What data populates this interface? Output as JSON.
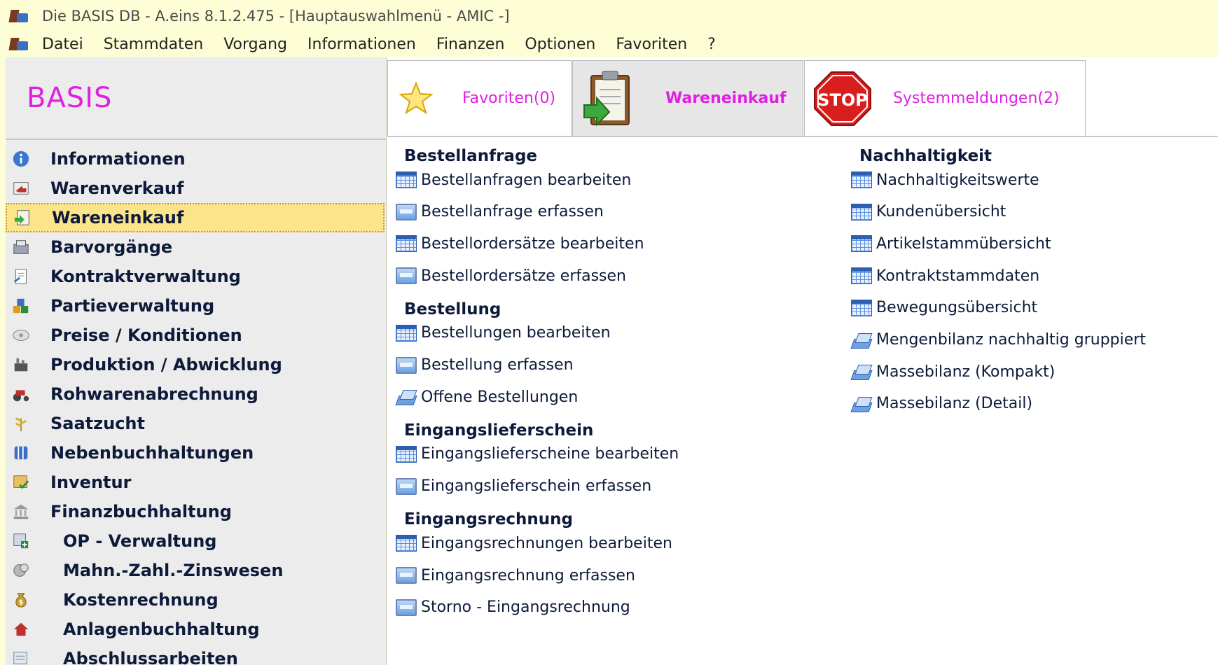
{
  "window": {
    "title": "Die BASIS DB - A.eins 8.1.2.475 - [Hauptauswahlmenü - AMIC -]"
  },
  "menu": [
    "Datei",
    "Stammdaten",
    "Vorgang",
    "Informationen",
    "Finanzen",
    "Optionen",
    "Favoriten",
    "?"
  ],
  "brand": "BASIS",
  "nav": [
    {
      "label": "Informationen",
      "icon": "info-icon"
    },
    {
      "label": "Warenverkauf",
      "icon": "sales-icon"
    },
    {
      "label": "Wareneinkauf",
      "icon": "purchase-icon",
      "active": true
    },
    {
      "label": "Barvorgänge",
      "icon": "cash-icon"
    },
    {
      "label": "Kontraktverwaltung",
      "icon": "contract-icon"
    },
    {
      "label": "Partieverwaltung",
      "icon": "batch-icon"
    },
    {
      "label": "Preise / Konditionen",
      "icon": "price-icon"
    },
    {
      "label": "Produktion / Abwicklung",
      "icon": "production-icon"
    },
    {
      "label": "Rohwarenabrechnung",
      "icon": "tractor-icon"
    },
    {
      "label": "Saatzucht",
      "icon": "seed-icon"
    },
    {
      "label": "Nebenbuchhaltungen",
      "icon": "ledger-icon"
    },
    {
      "label": "Inventur",
      "icon": "inventory-icon"
    },
    {
      "label": "Finanzbuchhaltung",
      "icon": "bank-icon"
    },
    {
      "label": "OP - Verwaltung",
      "icon": "op-icon",
      "sub": true
    },
    {
      "label": "Mahn.-Zahl.-Zinswesen",
      "icon": "dunning-icon",
      "sub": true
    },
    {
      "label": "Kostenrechnung",
      "icon": "moneybag-icon",
      "sub": true
    },
    {
      "label": "Anlagenbuchhaltung",
      "icon": "assets-icon",
      "sub": true
    },
    {
      "label": "Abschlussarbeiten",
      "icon": "closing-icon",
      "sub": true
    }
  ],
  "tabs": [
    {
      "label": "Favoriten(0)",
      "icon": "star-icon"
    },
    {
      "label": "Wareneinkauf",
      "icon": "clipboard-icon",
      "active": true
    },
    {
      "label": "Systemmeldungen(2)",
      "icon": "stop-icon"
    }
  ],
  "sections_left": [
    {
      "title": "Bestellanfrage",
      "items": [
        {
          "label": "Bestellanfragen bearbeiten",
          "icon": "table-icon"
        },
        {
          "label": "Bestellanfrage erfassen",
          "icon": "form-icon"
        },
        {
          "label": "Bestellordersätze bearbeiten",
          "icon": "table-icon"
        },
        {
          "label": "Bestellordersätze erfassen",
          "icon": "form-icon"
        }
      ]
    },
    {
      "title": "Bestellung",
      "items": [
        {
          "label": "Bestellungen bearbeiten",
          "icon": "table-icon"
        },
        {
          "label": "Bestellung erfassen",
          "icon": "form-icon"
        },
        {
          "label": "Offene Bestellungen",
          "icon": "report-icon"
        }
      ]
    },
    {
      "title": "Eingangslieferschein",
      "items": [
        {
          "label": "Eingangslieferscheine bearbeiten",
          "icon": "table-icon"
        },
        {
          "label": "Eingangslieferschein erfassen",
          "icon": "form-icon"
        }
      ]
    },
    {
      "title": "Eingangsrechnung",
      "items": [
        {
          "label": "Eingangsrechnungen bearbeiten",
          "icon": "table-icon"
        },
        {
          "label": "Eingangsrechnung erfassen",
          "icon": "form-icon"
        },
        {
          "label": "Storno - Eingangsrechnung",
          "icon": "form-icon"
        }
      ]
    }
  ],
  "sections_right": [
    {
      "title": "Nachhaltigkeit",
      "items": [
        {
          "label": "Nachhaltigkeitswerte",
          "icon": "table-icon"
        },
        {
          "label": "Kundenübersicht",
          "icon": "table-icon"
        },
        {
          "label": "Artikelstammübersicht",
          "icon": "table-icon"
        },
        {
          "label": "Kontraktstammdaten",
          "icon": "table-icon"
        },
        {
          "label": "Bewegungsübersicht",
          "icon": "table-icon"
        },
        {
          "label": "Mengenbilanz nachhaltig gruppiert",
          "icon": "report-icon"
        },
        {
          "label": "Massebilanz (Kompakt)",
          "icon": "report-icon"
        },
        {
          "label": "Massebilanz (Detail)",
          "icon": "report-icon"
        }
      ]
    }
  ],
  "colors": {
    "accent": "#e020e0",
    "background": "#fefed6",
    "active_nav": "#fbe48a",
    "text": "#0d1a3a"
  }
}
